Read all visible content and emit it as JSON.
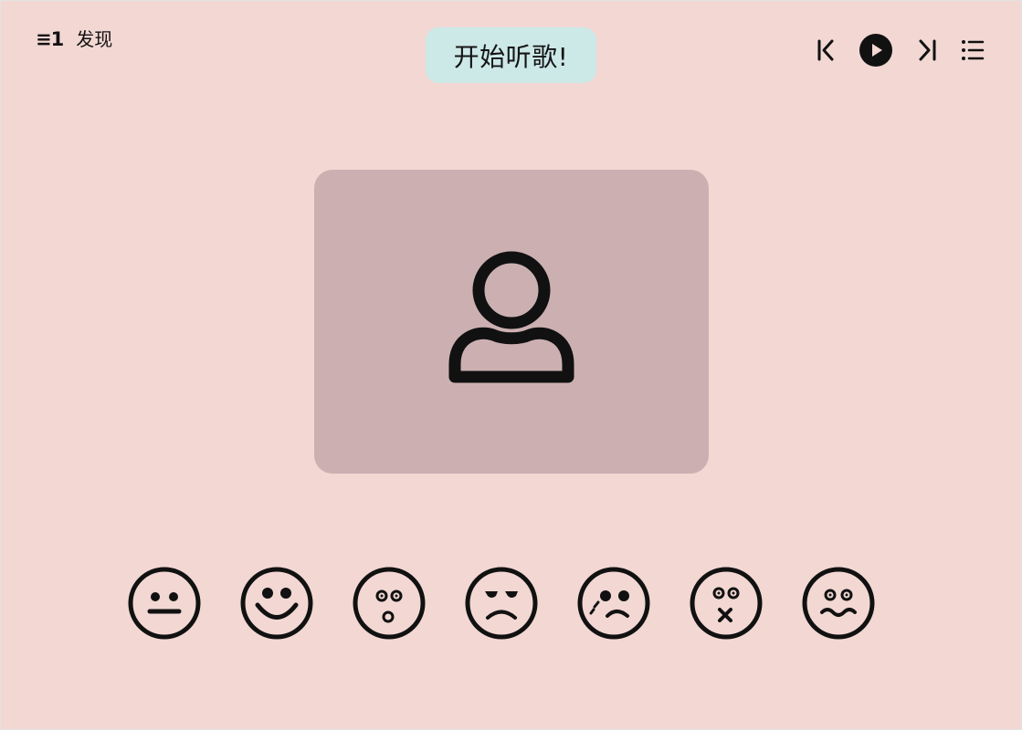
{
  "nav": {
    "menu_glyph": "≡1",
    "discover_label": "发现"
  },
  "title": {
    "text": "开始听歌!"
  },
  "player_controls": [
    "previous-icon",
    "play-icon",
    "next-icon",
    "playlist-icon"
  ],
  "album_art": {
    "icon": "user-icon",
    "background": "#ccb0b1"
  },
  "moods": [
    "neutral-face-icon",
    "smile-face-icon",
    "surprised-face-icon",
    "annoyed-face-icon",
    "crying-face-icon",
    "dizzy-face-icon",
    "wavy-face-icon"
  ],
  "colors": {
    "background": "#f2d7d3",
    "title_pill": "#cce9e8",
    "album_art": "#ccb0b1",
    "foreground": "#111111"
  }
}
